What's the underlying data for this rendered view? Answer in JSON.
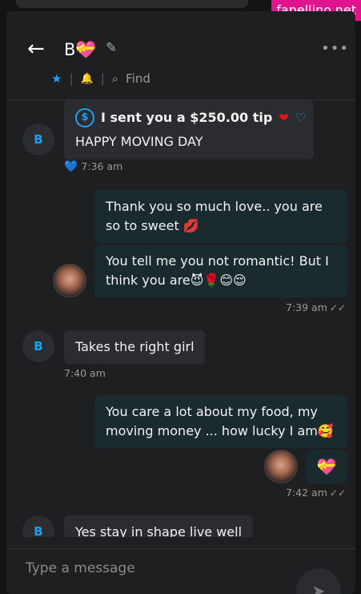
{
  "watermark": "fapellino.net",
  "header": {
    "back_glyph": "←",
    "title": "B💝",
    "edit_glyph": "✎",
    "more_glyph": "•••",
    "find_label": "Find",
    "icons": [
      "star-icon",
      "bell-icon",
      "search-icon"
    ]
  },
  "messages": {
    "m1_tip_line": "I sent you a $250.00 tip",
    "m1_tip_icon": "$",
    "m1_text": "HAPPY MOVING DAY",
    "m1_heart": "💙",
    "m1_time": "7:36 am",
    "m2_text": "Thank you so much love.. you are so to sweet 💋",
    "m3_text": "You tell me you not romantic! But I think you are😈🌹😊😌",
    "m3_time": "7:39 am",
    "m4_text": "Takes the right girl",
    "m4_time": "7:40 am",
    "m5_text": "You care a lot about my food, my moving money ... how lucky I am🥰",
    "m6_text": "💝",
    "m6_time": "7:42 am",
    "m7_text": "Yes stay in shape live well"
  },
  "avatar_letter": "B",
  "footer": {
    "placeholder": "Type a message",
    "send_glyph": "➤"
  }
}
